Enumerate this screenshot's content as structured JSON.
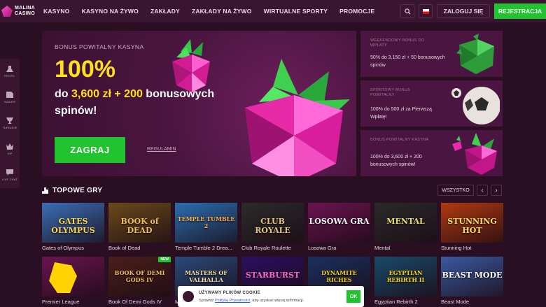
{
  "brand": {
    "name_line1": "MALINA",
    "name_line2": "CASINO"
  },
  "nav": [
    "KASYNO",
    "KASYNO NA ŻYWO",
    "ZAKŁADY",
    "ZAKŁADY NA ŻYWO",
    "WIRTUALNE SPORTY",
    "PROMOCJE"
  ],
  "header": {
    "login_label": "ZALOGUJ SIĘ",
    "register_label": "REJESTRACJA"
  },
  "rail": [
    "PROFIL",
    "KASIER",
    "TURNIEJE",
    "VIP",
    "LIVE CHAT"
  ],
  "hero": {
    "kicker": "BONUS POWITALNY KASYNA",
    "big": "100%",
    "line1_pre": "do ",
    "line1_hl": "3,600 zł + 200",
    "line1_post": " bonusowych",
    "line2": "spinów!",
    "cta": "ZAGRAJ",
    "regulamin": "REGULAMIN"
  },
  "promos": [
    {
      "kicker": "WEEKENDOWY BONUS DO WPŁATY",
      "text": "50% do 3,150 zł + 50 bonusowych spinów"
    },
    {
      "kicker": "SPORTOWY BONUS POWITALNY",
      "text": "100% do 500 zł za Pierwszą Wpłatę!"
    },
    {
      "kicker": "BONUS POWITALNY KASYNA",
      "text": "100% do 3,600 zł + 200 bonusowych spinów!"
    }
  ],
  "section": {
    "title": "TOPOWE GRY",
    "all_label": "WSZYSTKO",
    "prev": "‹",
    "next": "›"
  },
  "games_row1": [
    {
      "name": "Gates of Olympus",
      "art": "GATES\nOLYMPUS",
      "bg": "#3a6fb5",
      "fg": "#ffd84a"
    },
    {
      "name": "Book of Dead",
      "art": "BOOK of DEAD",
      "bg": "#6b4a1a",
      "fg": "#f2c15a"
    },
    {
      "name": "Temple Tumble 2 Drea...",
      "art": "TEMPLE TUMBLE 2",
      "bg": "#2a6fb0",
      "fg": "#ffb347"
    },
    {
      "name": "Club Royale Roulette",
      "art": "CLUB ROYALE",
      "bg": "#2b2b2b",
      "fg": "#e8c77a"
    },
    {
      "name": "Losowa Gra",
      "art": "LOSOWA GRA",
      "bg": "#6a1550",
      "fg": "#ffffff"
    },
    {
      "name": "Mental",
      "art": "MENTAL",
      "bg": "#2a2a2a",
      "fg": "#e8e070"
    },
    {
      "name": "Stunning Hot",
      "art": "STUNNING HOT",
      "bg": "#b03a0f",
      "fg": "#ffe066"
    }
  ],
  "games_row2": [
    {
      "name": "Premier League",
      "art": "",
      "bg": "#6a1550",
      "fg": "#ffd200",
      "new": ""
    },
    {
      "name": "Book Of Demi Gods IV",
      "art": "BOOK OF DEMI GODS IV",
      "bg": "#4a1f1a",
      "fg": "#f2c15a",
      "new": "NEW"
    },
    {
      "name": "Masters of Valhalla",
      "art": "MASTERS OF VALHALLA",
      "bg": "#2a4a7a",
      "fg": "#f2e0a0",
      "new": ""
    },
    {
      "name": "Starburst",
      "art": "STARBURST",
      "bg": "#2a1060",
      "fg": "#ff66cc",
      "new": ""
    },
    {
      "name": "Dynamite Riches",
      "art": "DYNAMITE RICHES",
      "bg": "#1a3060",
      "fg": "#ffd200",
      "new": ""
    },
    {
      "name": "Egyptian Rebirth 2",
      "art": "EGYPTIAN REBIRTH II",
      "bg": "#1a4a6a",
      "fg": "#ffd200",
      "new": ""
    },
    {
      "name": "Beast Mode",
      "art": "BEAST MODE",
      "bg": "#3a5aa0",
      "fg": "#ffffff",
      "new": ""
    }
  ],
  "cookie": {
    "title": "UŻYWAMY PLIKÓW COOKIE",
    "pre": "Sprawdź ",
    "link": "Politykę Prywatności",
    "post": ", aby uzyskać więcej informacji.",
    "ok": "OK"
  },
  "colors": {
    "accent_green": "#1fc42e",
    "hero_yellow": "#ffe01a",
    "bg": "#2a0f22",
    "panel": "#4a1540"
  }
}
